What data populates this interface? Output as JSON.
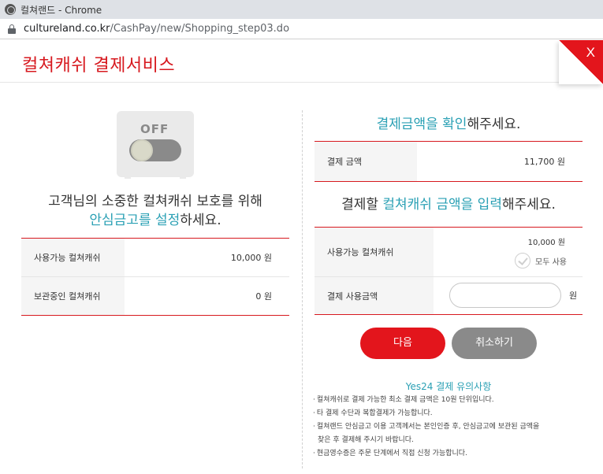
{
  "browser": {
    "window_title": "컬쳐랜드 - Chrome",
    "url_host": "cultureland.co.kr",
    "url_path": "/CashPay/new/Shopping_step03.do"
  },
  "header": {
    "title": "컬쳐캐쉬 결제서비스",
    "close_label": "X"
  },
  "left": {
    "toggle_label": "OFF",
    "protect_line1": "고객님의 소중한 컬쳐캐쉬 보호를 위해",
    "protect_line2_highlight": "안심금고를 설정",
    "protect_line2_rest": "하세요.",
    "rows": [
      {
        "label": "사용가능 컬쳐캐쉬",
        "value": "10,000 원"
      },
      {
        "label": "보관중인 컬쳐캐쉬",
        "value": "0 원"
      }
    ]
  },
  "right": {
    "confirm_highlight1": "결제금액을",
    "confirm_highlight2": "확인",
    "confirm_rest": "해주세요.",
    "payment_label": "결제 금액",
    "payment_value": "11,700 원",
    "enter_prefix": "결제할",
    "enter_highlight": "컬쳐캐쉬 금액을 입력",
    "enter_rest": "해주세요.",
    "available_label": "사용가능 컬쳐캐쉬",
    "available_value": "10,000 원",
    "use_all_label": "모두 사용",
    "use_amount_label": "결제 사용금액",
    "use_amount_value": "",
    "use_amount_unit": "원",
    "next_button": "다음",
    "cancel_button": "취소하기",
    "notice_title": "Yes24 결제 유의사항",
    "notices": [
      "컬쳐캐쉬로 결제 가능한 최소 결제 금액은 10원 단위입니다.",
      "타 결제 수단과 복합결제가 가능합니다.",
      "컬쳐랜드 안심금고 이용 고객께서는 본인인증 후, 안심금고에 보관된 금액을",
      "찾은 후 결제해 주시기 바랍니다.",
      "현금영수증은 주문 단계에서 직접 신청 가능합니다."
    ]
  },
  "colors": {
    "brand_red": "#d7191f",
    "accent_teal": "#2aa0b4",
    "button_gray": "#8a8a8a"
  }
}
